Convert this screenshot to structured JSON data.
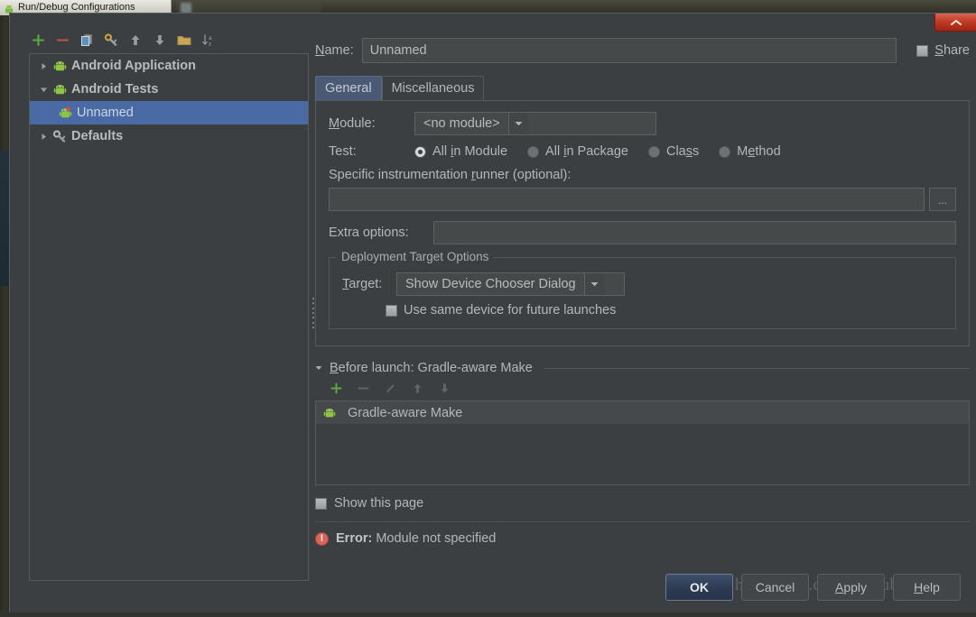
{
  "taskbar": {
    "active_title": "Run/Debug Configurations",
    "inactive_title": ""
  },
  "window": {
    "title": "Run/Debug Configurations",
    "close_label": "Close"
  },
  "tree_toolbar": {
    "buttons": [
      {
        "name": "add-icon",
        "tip": "Add New Configuration"
      },
      {
        "name": "remove-icon",
        "tip": "Remove Configuration"
      },
      {
        "name": "copy-icon",
        "tip": "Copy Configuration"
      },
      {
        "name": "save-configuration-icon",
        "tip": "Save Configuration"
      },
      {
        "name": "move-up-icon",
        "tip": "Move Up"
      },
      {
        "name": "move-down-icon",
        "tip": "Move Down"
      },
      {
        "name": "folder-icon",
        "tip": "Create New Folder"
      },
      {
        "name": "sort-alphabetically-icon",
        "tip": "Sort Configurations"
      }
    ]
  },
  "tree": {
    "items": [
      {
        "label": "Android Application",
        "expanded": false,
        "selected": false,
        "level": 0,
        "icon": "android-icon"
      },
      {
        "label": "Android Tests",
        "expanded": true,
        "selected": false,
        "level": 0,
        "icon": "android-icon"
      },
      {
        "label": "Unnamed",
        "expanded": null,
        "selected": true,
        "level": 1,
        "icon": "android-test-icon"
      },
      {
        "label": "Defaults",
        "expanded": false,
        "selected": false,
        "level": 0,
        "icon": "wrench-icon"
      }
    ]
  },
  "form": {
    "name_label": "Name:",
    "name_label_mnemonic": "N",
    "name_value": "Unnamed",
    "name_placeholder": "",
    "share_label": "Share",
    "share_mnemonic": "S",
    "share_checked": false,
    "tabs": [
      {
        "label": "General",
        "active": true
      },
      {
        "label": "Miscellaneous",
        "active": false
      }
    ],
    "module_label": "Module:",
    "module_mnemonic": "M",
    "module_value": "<no module>",
    "test_label": "Test:",
    "test_options": [
      {
        "label": "All in Module",
        "mnemonic": "M",
        "selected": true
      },
      {
        "label": "All in Package",
        "mnemonic": "i",
        "selected": false
      },
      {
        "label": "Class",
        "mnemonic": "s",
        "selected": false
      },
      {
        "label": "Method",
        "mnemonic": "e",
        "selected": false
      }
    ],
    "runner_label": "Specific instrumentation runner (optional):",
    "runner_mnemonic": "r",
    "runner_value": "",
    "runner_browse_label": "...",
    "extra_options_label": "Extra options:",
    "extra_options_value": "",
    "deployment_group_title": "Deployment Target Options",
    "target_label": "Target:",
    "target_mnemonic": "T",
    "target_value": "Show Device Chooser Dialog",
    "same_device_label": "Use same device for future launches",
    "same_device_checked": false
  },
  "before_launch": {
    "title_prefix": "Before launch: ",
    "title_value": "Gradle-aware Make",
    "title_mnemonic": "B",
    "expanded": true,
    "toolbar": [
      {
        "name": "add-icon",
        "enabled": true
      },
      {
        "name": "remove-icon",
        "enabled": false
      },
      {
        "name": "edit-pencil-icon",
        "enabled": false
      },
      {
        "name": "move-up-icon",
        "enabled": false
      },
      {
        "name": "move-down-icon",
        "enabled": false
      }
    ],
    "items": [
      {
        "label": "Gradle-aware Make",
        "icon": "android-icon",
        "highlighted": true
      }
    ],
    "show_page_label": "Show this page",
    "show_page_checked": false
  },
  "status": {
    "error_prefix": "Error:",
    "error_message": "Module not specified",
    "error_color": "#d4665a"
  },
  "buttons": [
    {
      "label": "OK",
      "primary": true,
      "name": "ok-button"
    },
    {
      "label": "Cancel",
      "primary": false,
      "name": "cancel-button"
    },
    {
      "label": "Apply",
      "primary": false,
      "name": "apply-button",
      "mnemonic": "A"
    },
    {
      "label": "Help",
      "primary": false,
      "name": "help-button",
      "mnemonic": "H"
    }
  ],
  "watermark": {
    "text": "http://blog.csdn.net/tubaba"
  },
  "colors": {
    "window_bg": "#3c3f41",
    "selection": "#4a6aa5",
    "tab_active": "#4a5a75",
    "accent_green": "#62b143",
    "accent_red": "#c8563f",
    "text": "#b4b7b8"
  }
}
